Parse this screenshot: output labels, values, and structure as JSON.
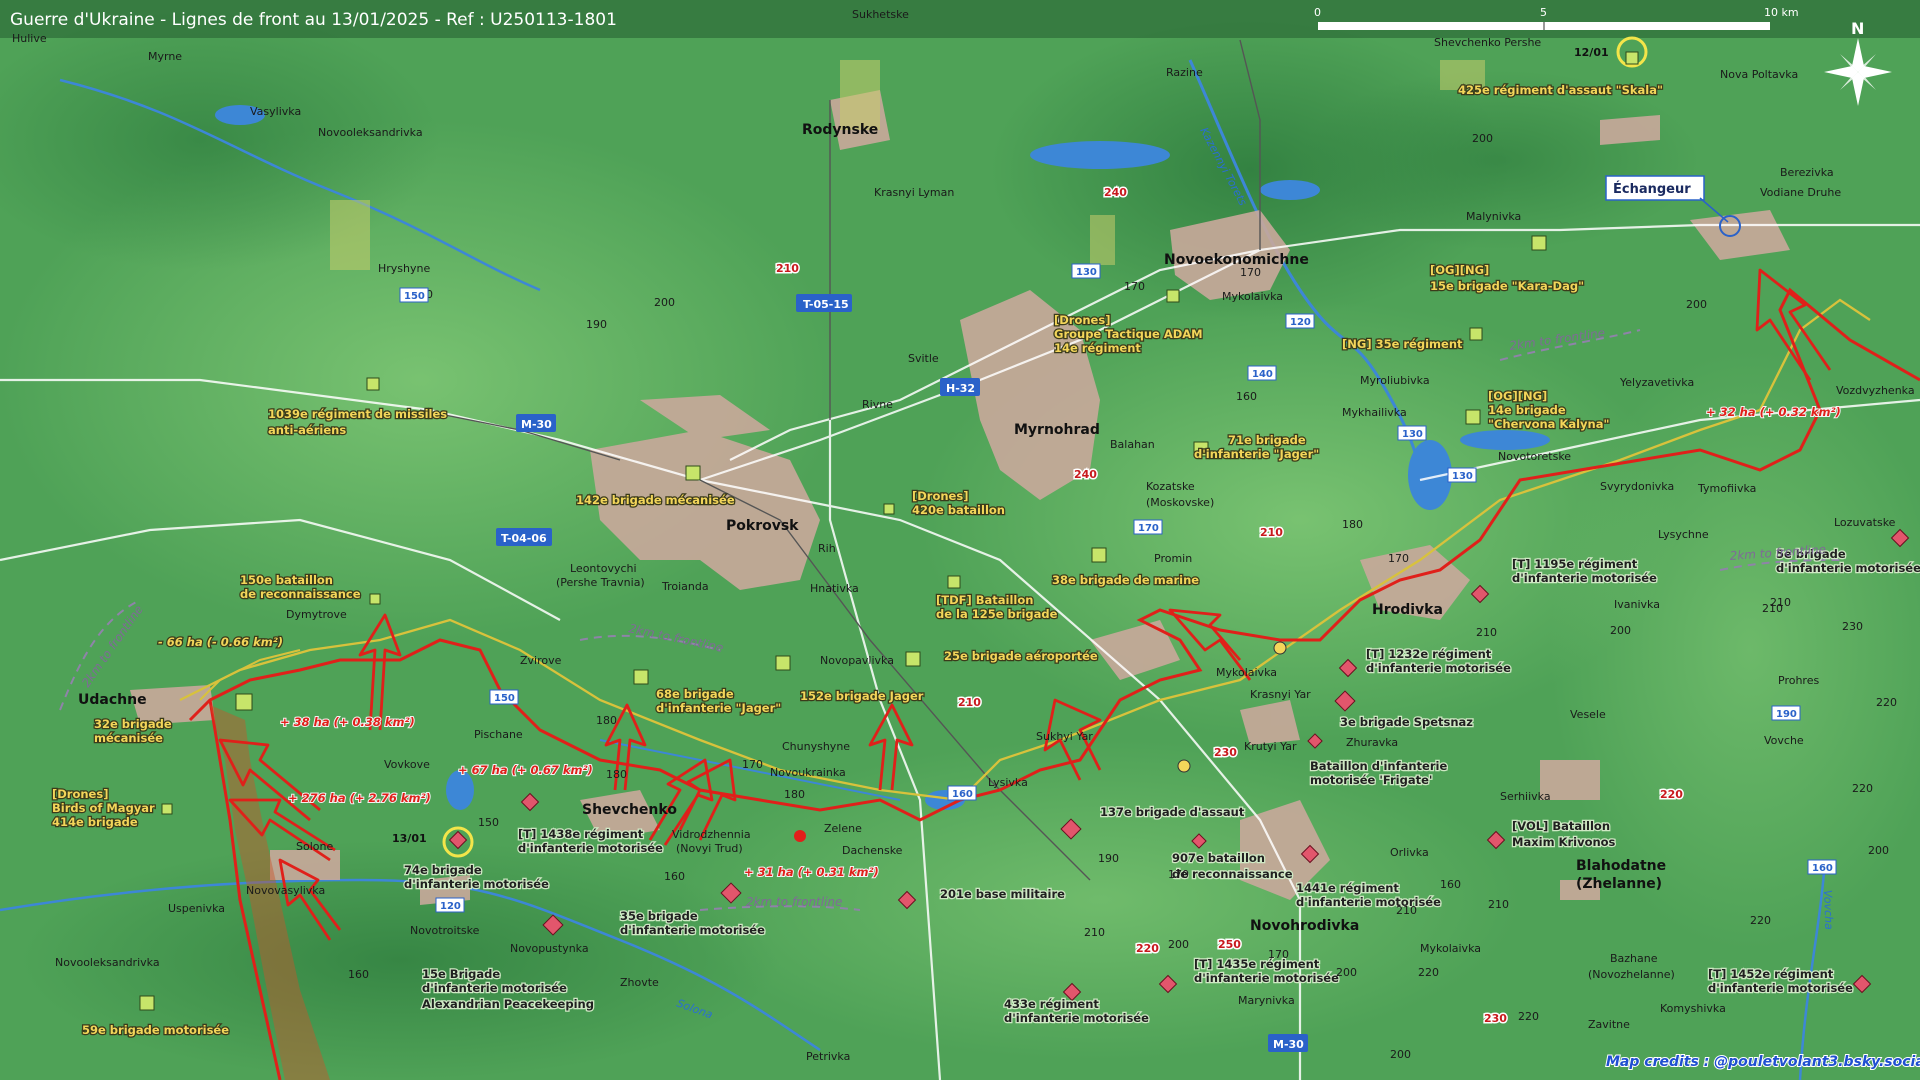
{
  "map": {
    "title": "Guerre d'Ukraine - Lignes de front au 13/01/2025 - Ref : U250113-1801",
    "north_label": "N",
    "scale_labels": [
      "0",
      "5",
      "10 km"
    ],
    "credits": "Map credits : @pouletvolant3.bsky.social",
    "interchange_label": "Échangeur",
    "date_markers": [
      "12/01",
      "13/01"
    ],
    "major_towns": [
      "Pokrovsk",
      "Myrnohrad",
      "Novoekonomichne",
      "Rodynske",
      "Hrodivka",
      "Udachne",
      "Shevchenko",
      "Novohrodivka",
      "Blahodatne",
      "(Zhelanne)"
    ],
    "towns": [
      "Hulive",
      "Myrne",
      "Vasylivka",
      "Novooleksandrivka",
      "Hryshyne",
      "Krasnyi Lyman",
      "Svitle",
      "Rivne",
      "Rih",
      "Hnativka",
      "Leontovychi",
      "(Pershe Travnia)",
      "Troianda",
      "Dymytrove",
      "Zvirove",
      "Pischane",
      "Vovkove",
      "Solone",
      "Novovasylivka",
      "Uspenivka",
      "Novotroitske",
      "Novopustynka",
      "Zhovte",
      "Petrivka",
      "Novooleksandrivka",
      "Vidrodzhennia",
      "(Novyi Trud)",
      "Zelene",
      "Dachenske",
      "Chunyshyne",
      "Novoukrainka",
      "Novopavlivka",
      "Lysivka",
      "Sukhyi Yar",
      "Mykolaivka",
      "Krasnyi Yar",
      "Krutyi Yar",
      "Zhuravka",
      "Promin",
      "Kozatske",
      "(Moskovske)",
      "Balahan",
      "Mykolaivka",
      "Myroliubivka",
      "Mykhailivka",
      "Novotoretske",
      "Svyrydonivka",
      "Yelyzavetivka",
      "Tymofiivka",
      "Lozuvatske",
      "Lysychne",
      "Ivanivka",
      "Vesele",
      "Prohres",
      "Vovche",
      "Serhiivka",
      "Orlivka",
      "Mykolaivka",
      "Bazhane",
      "(Novozhelanne)",
      "Komyshivka",
      "Zavitne",
      "Marynivka",
      "Sukhetske",
      "Razine",
      "Shevchenko Pershe",
      "Nova Poltavka",
      "Malynivka",
      "Berezivka",
      "Vodiane Druhe",
      "Vozdvyzhenka"
    ],
    "road_shields": [
      "T-05-15",
      "H-32",
      "M-30",
      "T-04-06",
      "M-30"
    ],
    "friendly_units": [
      "425e régiment d'assaut \"Skala\"",
      "[OG][NG]",
      "15e brigade \"Kara-Dag\"",
      "[NG] 35e régiment",
      "[OG][NG]",
      "14e brigade",
      "\"Chervona Kalyna\"",
      "[Drones]",
      "Groupe Tactique ADAM",
      "14e régiment",
      "71e brigade",
      "d'infanterie \"Jager\"",
      "1039e régiment de missiles",
      "anti-aériens",
      "142e brigade mécanisée",
      "[Drones]",
      "420e bataillon",
      "150e bataillon",
      "de reconnaissance",
      "38e brigade de marine",
      "[TDF] Bataillon",
      "de la 125e brigade",
      "25e brigade aéroportée",
      "68e brigade",
      "d'infanterie \"Jager\"",
      "152e brigade Jager",
      "32e brigade",
      "mécanisée",
      "[Drones]",
      "Birds of Magyar",
      "414e brigade",
      "59e brigade motorisée"
    ],
    "enemy_units": [
      "[T] 1195e régiment",
      "d'infanterie motorisée",
      "5e brigade",
      "d'infanterie motorisée",
      "[T] 1232e régiment",
      "d'infanterie motorisée",
      "3e brigade Spetsnaz",
      "Bataillon d'infanterie",
      "motorisée 'Frigate'",
      "[VOL] Bataillon",
      "Maxim Krivonos",
      "137e brigade d'assaut",
      "907e bataillon",
      "de reconnaissance",
      "1441e régiment",
      "d'infanterie motorisée",
      "[T] 1435e régiment",
      "d'infanterie motorisée",
      "433e régiment",
      "d'infanterie motorisée",
      "[T] 1452e régiment",
      "d'infanterie motorisée",
      "201e base militaire",
      "[T] 1438e régiment",
      "d'infanterie motorisée",
      "74e brigade",
      "d'infanterie motorisée",
      "35e brigade",
      "d'infanterie motorisée",
      "15e Brigade",
      "d'infanterie motorisée",
      "Alexandrian Peacekeeping"
    ],
    "area_changes": [
      "+ 32 ha (+ 0.32 km²)",
      "+ 38 ha (+ 0.38 km²)",
      "+ 67 ha (+ 0.67 km²)",
      "+ 276 ha (+ 2.76 km²)",
      "+ 31 ha (+ 0.31 km²)",
      "- 66 ha (- 0.66 km²)"
    ],
    "frontline_labels": [
      "2km to frontline",
      "2km to frontline",
      "2km to frontline",
      "2km to frontline",
      "2km to frontline"
    ],
    "river_labels": [
      "Kazennyi Torets",
      "Solona",
      "Vovcha"
    ],
    "altitudes_black": [
      "200",
      "170",
      "200",
      "150",
      "200",
      "190",
      "170",
      "160",
      "180",
      "170",
      "210",
      "200",
      "210",
      "230",
      "220",
      "220",
      "200",
      "210",
      "180",
      "150",
      "180",
      "170",
      "180",
      "160",
      "160",
      "190",
      "210",
      "200",
      "170",
      "210",
      "220",
      "200",
      "170",
      "210",
      "160",
      "220",
      "220",
      "200"
    ],
    "altitudes_red": [
      "240",
      "210",
      "240",
      "210",
      "210",
      "230",
      "220",
      "250",
      "230",
      "220"
    ],
    "road_numbers": [
      "150",
      "130",
      "120",
      "140",
      "130",
      "130",
      "170",
      "150",
      "120",
      "160",
      "190",
      "160"
    ]
  },
  "colors": {
    "terrain": "#4fa257",
    "urban": "#c9a99b",
    "frontline": "#e0201a",
    "previous_line": "#d8c23c",
    "water": "#3d87d6",
    "road_shield": "#2a62c9"
  }
}
